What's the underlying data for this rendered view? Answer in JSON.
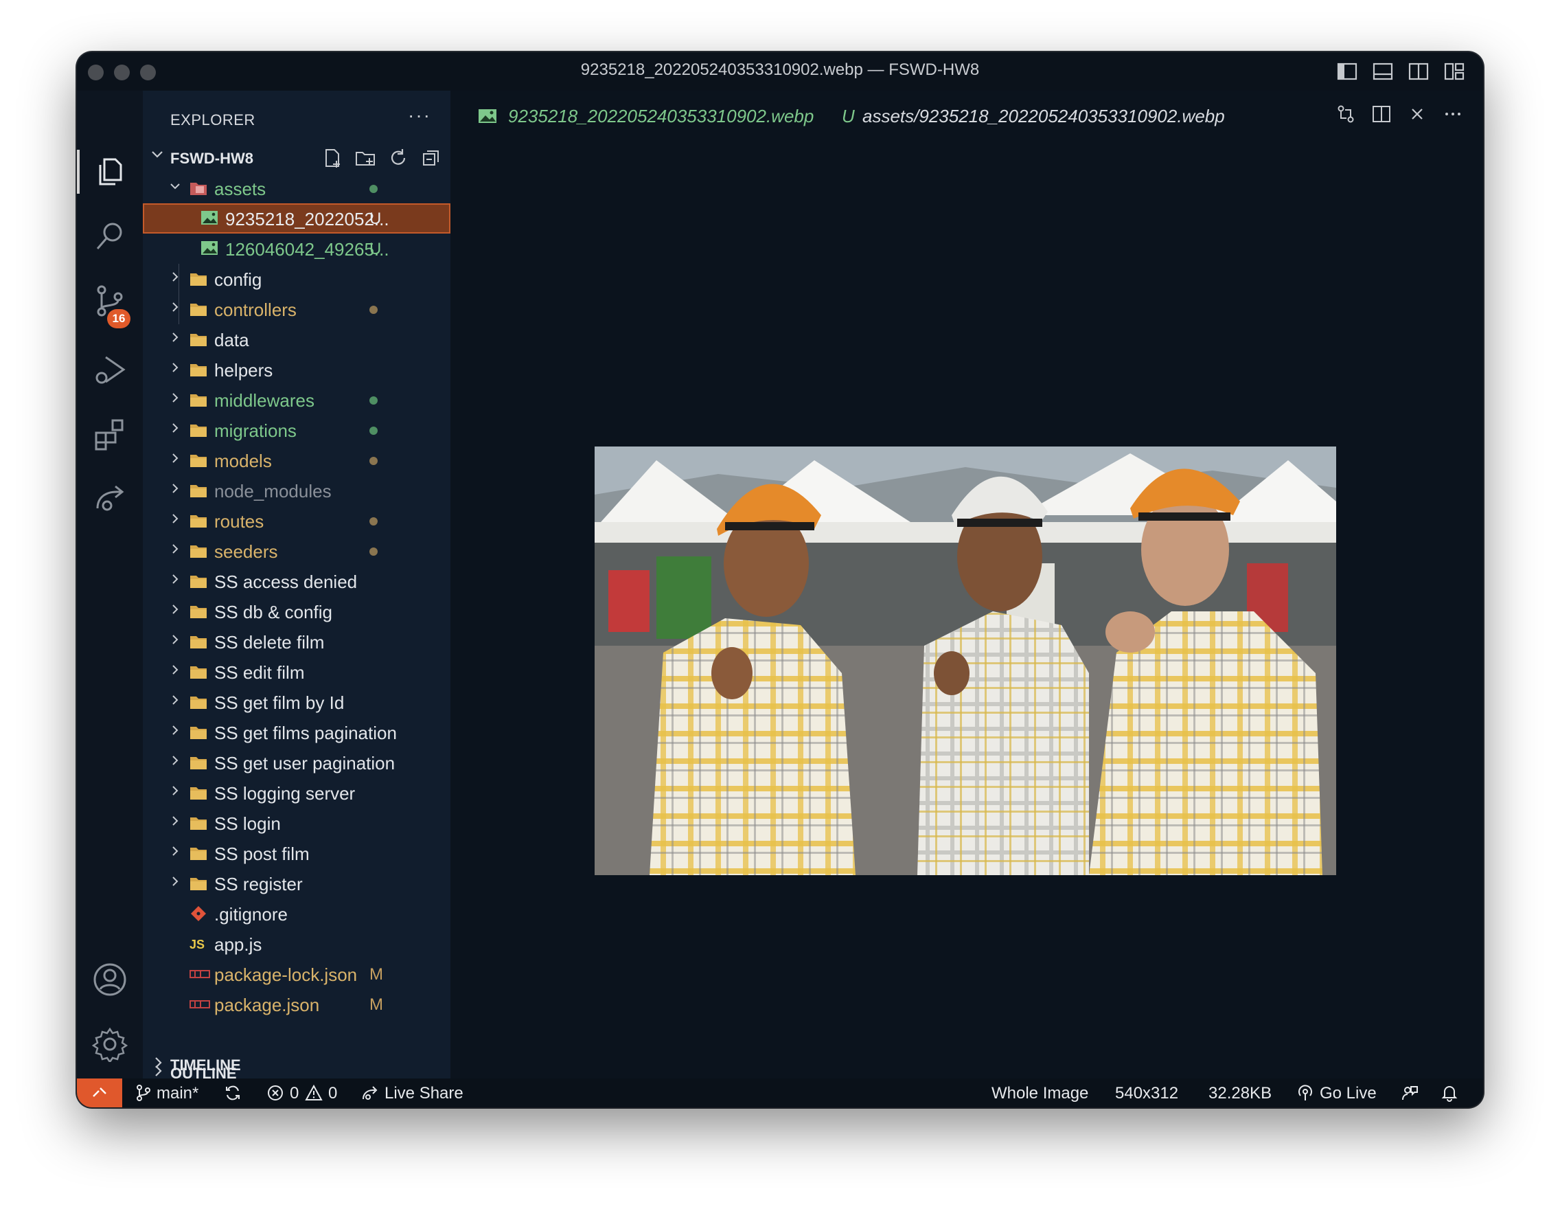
{
  "window": {
    "title": "9235218_202205240353310902.webp — FSWD-HW8"
  },
  "activity_bar": {
    "source_control_badge": "16"
  },
  "sidebar": {
    "header": "EXPLORER",
    "more_label": "···",
    "project": "FSWD-HW8",
    "tree": [
      {
        "name": "assets",
        "kind": "folder-open",
        "color": "#7ec88b",
        "indicator": "dot",
        "indicator_color": "#4f8f63"
      },
      {
        "name": "9235218_2022052...",
        "kind": "image",
        "color": "#e9ecef",
        "indicator": "U",
        "indicator_color": "#e8ecef",
        "selected": true
      },
      {
        "name": "126046042_49265...",
        "kind": "image",
        "color": "#7ec88b",
        "indicator": "U",
        "indicator_color": "#7ec88b"
      },
      {
        "name": "config",
        "kind": "folder",
        "color": "#e3e6ea",
        "indicator": "",
        "indicator_color": ""
      },
      {
        "name": "controllers",
        "kind": "folder",
        "color": "#d9b36a",
        "indicator": "dot",
        "indicator_color": "#8a7550"
      },
      {
        "name": "data",
        "kind": "folder",
        "color": "#e3e6ea",
        "indicator": "",
        "indicator_color": ""
      },
      {
        "name": "helpers",
        "kind": "folder",
        "color": "#e3e6ea",
        "indicator": "",
        "indicator_color": ""
      },
      {
        "name": "middlewares",
        "kind": "folder",
        "color": "#7ec88b",
        "indicator": "dot",
        "indicator_color": "#4f8f63"
      },
      {
        "name": "migrations",
        "kind": "folder",
        "color": "#7ec88b",
        "indicator": "dot",
        "indicator_color": "#4f8f63"
      },
      {
        "name": "models",
        "kind": "folder",
        "color": "#d9b36a",
        "indicator": "dot",
        "indicator_color": "#8a7550"
      },
      {
        "name": "node_modules",
        "kind": "folder",
        "color": "#8a9099",
        "indicator": "",
        "indicator_color": ""
      },
      {
        "name": "routes",
        "kind": "folder",
        "color": "#d9b36a",
        "indicator": "dot",
        "indicator_color": "#8a7550"
      },
      {
        "name": "seeders",
        "kind": "folder",
        "color": "#d9b36a",
        "indicator": "dot",
        "indicator_color": "#8a7550"
      },
      {
        "name": "SS access denied",
        "kind": "folder",
        "color": "#e3e6ea",
        "indicator": "",
        "indicator_color": ""
      },
      {
        "name": "SS db & config",
        "kind": "folder",
        "color": "#e3e6ea",
        "indicator": "",
        "indicator_color": ""
      },
      {
        "name": "SS delete film",
        "kind": "folder",
        "color": "#e3e6ea",
        "indicator": "",
        "indicator_color": ""
      },
      {
        "name": "SS edit film",
        "kind": "folder",
        "color": "#e3e6ea",
        "indicator": "",
        "indicator_color": ""
      },
      {
        "name": "SS get film by Id",
        "kind": "folder",
        "color": "#e3e6ea",
        "indicator": "",
        "indicator_color": ""
      },
      {
        "name": "SS get films pagination",
        "kind": "folder",
        "color": "#e3e6ea",
        "indicator": "",
        "indicator_color": ""
      },
      {
        "name": "SS get user pagination",
        "kind": "folder",
        "color": "#e3e6ea",
        "indicator": "",
        "indicator_color": ""
      },
      {
        "name": "SS logging server",
        "kind": "folder",
        "color": "#e3e6ea",
        "indicator": "",
        "indicator_color": ""
      },
      {
        "name": "SS login",
        "kind": "folder",
        "color": "#e3e6ea",
        "indicator": "",
        "indicator_color": ""
      },
      {
        "name": "SS post film",
        "kind": "folder",
        "color": "#e3e6ea",
        "indicator": "",
        "indicator_color": ""
      },
      {
        "name": "SS register",
        "kind": "folder",
        "color": "#e3e6ea",
        "indicator": "",
        "indicator_color": ""
      },
      {
        "name": ".gitignore",
        "kind": "git",
        "color": "#e3e6ea",
        "indicator": "",
        "indicator_color": ""
      },
      {
        "name": "app.js",
        "kind": "js",
        "color": "#e3e6ea",
        "indicator": "",
        "indicator_color": ""
      },
      {
        "name": "package-lock.json",
        "kind": "npm",
        "color": "#d9b36a",
        "indicator": "M",
        "indicator_color": "#c8a060"
      },
      {
        "name": "package.json",
        "kind": "npm",
        "color": "#d9b36a",
        "indicator": "M",
        "indicator_color": "#c8a060"
      }
    ],
    "sections": [
      "OUTLINE",
      "TIMELINE"
    ]
  },
  "editor": {
    "tab_name": "9235218_202205240353310902.webp",
    "tab_status": "U",
    "tab_path": "assets/9235218_202205240353310902.webp"
  },
  "statusbar": {
    "branch": "main*",
    "errors": "0",
    "warnings": "0",
    "live_share": "Live Share",
    "zoom": "Whole Image",
    "dimensions": "540x312",
    "file_size": "32.28KB",
    "go_live": "Go Live"
  },
  "colors": {
    "accent": "#e0582c",
    "git_untracked": "#7ec88b",
    "git_modified": "#d9b36a"
  }
}
